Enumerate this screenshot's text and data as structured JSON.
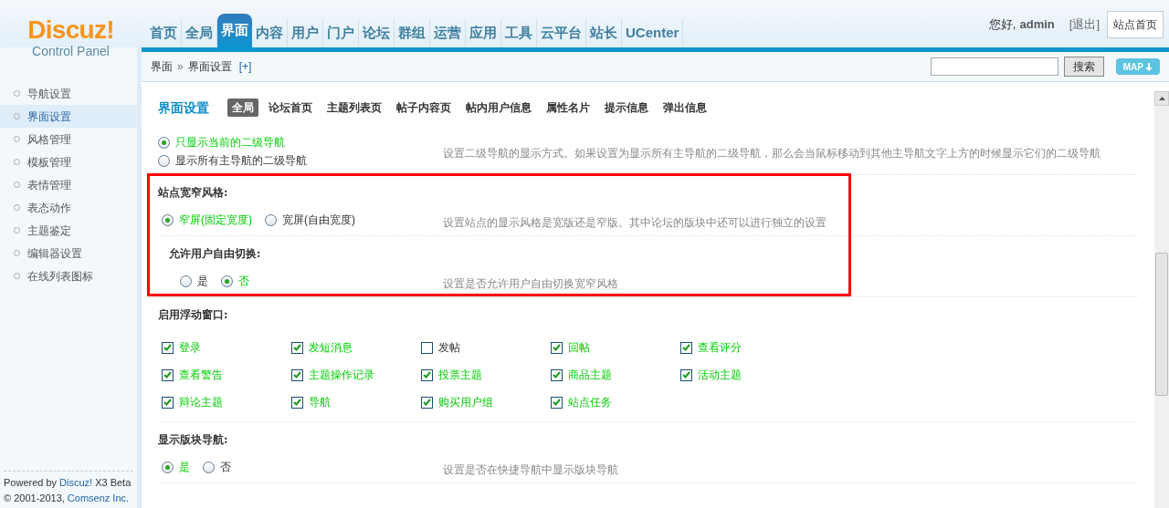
{
  "header": {
    "logo": {
      "brand": "Discuz!",
      "subtitle": "Control Panel"
    },
    "nav": [
      {
        "label": "首页",
        "selected": false
      },
      {
        "label": "全局",
        "selected": false
      },
      {
        "label": "界面",
        "selected": true
      },
      {
        "label": "内容",
        "selected": false
      },
      {
        "label": "用户",
        "selected": false
      },
      {
        "label": "门户",
        "selected": false
      },
      {
        "label": "论坛",
        "selected": false
      },
      {
        "label": "群组",
        "selected": false
      },
      {
        "label": "运营",
        "selected": false
      },
      {
        "label": "应用",
        "selected": false
      },
      {
        "label": "工具",
        "selected": false
      },
      {
        "label": "云平台",
        "selected": false
      },
      {
        "label": "站长",
        "selected": false
      },
      {
        "label": "UCenter",
        "selected": false
      }
    ],
    "greeting": "您好,",
    "username": "admin",
    "logout": "[退出]",
    "home_button": "站点首页"
  },
  "breadcrumb": {
    "items": [
      "界面",
      "界面设置"
    ],
    "separator": "»",
    "add": "[+]"
  },
  "search": {
    "button": "搜索",
    "map_button": "MAP"
  },
  "sidebar": {
    "items": [
      {
        "label": "导航设置",
        "selected": false
      },
      {
        "label": "界面设置",
        "selected": true
      },
      {
        "label": "风格管理",
        "selected": false
      },
      {
        "label": "模板管理",
        "selected": false
      },
      {
        "label": "表情管理",
        "selected": false
      },
      {
        "label": "表态动作",
        "selected": false
      },
      {
        "label": "主题鉴定",
        "selected": false
      },
      {
        "label": "编辑器设置",
        "selected": false
      },
      {
        "label": "在线列表图标",
        "selected": false
      }
    ],
    "footer": {
      "powered": "Powered by",
      "product": "Discuz!",
      "version": "X3 Beta",
      "copyright": "© 2001-2013,",
      "company": "Comsenz Inc."
    }
  },
  "page": {
    "title": "界面设置",
    "tabs": [
      {
        "label": "全局",
        "selected": true
      },
      {
        "label": "论坛首页",
        "selected": false
      },
      {
        "label": "主题列表页",
        "selected": false
      },
      {
        "label": "帖子内容页",
        "selected": false
      },
      {
        "label": "帖内用户信息",
        "selected": false
      },
      {
        "label": "属性名片",
        "selected": false
      },
      {
        "label": "提示信息",
        "selected": false
      },
      {
        "label": "弹出信息",
        "selected": false
      }
    ]
  },
  "settings": [
    {
      "kind": "radio_stacked",
      "highlighted": false,
      "options": [
        {
          "label": "只显示当前的二级导航",
          "selected": true
        },
        {
          "label": "显示所有主导航的二级导航",
          "selected": false
        }
      ],
      "description": "设置二级导航的显示方式。如果设置为显示所有主导航的二级导航，那么会当鼠标移动到其他主导航文字上方的时候显示它们的二级导航"
    },
    {
      "kind": "radio",
      "highlighted": true,
      "title": "站点宽窄风格:",
      "options": [
        {
          "label": "窄屏(固定宽度)",
          "selected": true
        },
        {
          "label": "宽屏(自由宽度)",
          "selected": false
        }
      ],
      "description": "设置站点的显示风格是宽版还是窄版。其中论坛的版块中还可以进行独立的设置"
    },
    {
      "kind": "sub_radio",
      "highlighted": true,
      "title": "允许用户自由切换:",
      "options": [
        {
          "label": "是",
          "selected": false
        },
        {
          "label": "否",
          "selected": true
        }
      ],
      "description": "设置是否允许用户自由切换宽窄风格"
    },
    {
      "kind": "checkboxes",
      "highlighted": false,
      "title": "启用浮动窗口:",
      "options": [
        {
          "label": "登录",
          "checked": true
        },
        {
          "label": "发短消息",
          "checked": true
        },
        {
          "label": "发帖",
          "checked": false
        },
        {
          "label": "回帖",
          "checked": true
        },
        {
          "label": "查看评分",
          "checked": true
        },
        {
          "label": "查看警告",
          "checked": true
        },
        {
          "label": "主题操作记录",
          "checked": true
        },
        {
          "label": "投票主题",
          "checked": true
        },
        {
          "label": "商品主题",
          "checked": true
        },
        {
          "label": "活动主题",
          "checked": true
        },
        {
          "label": "辩论主题",
          "checked": true
        },
        {
          "label": "导航",
          "checked": true
        },
        {
          "label": "购买用户组",
          "checked": true
        },
        {
          "label": "站点任务",
          "checked": true
        }
      ]
    },
    {
      "kind": "radio",
      "highlighted": false,
      "title": "显示版块导航:",
      "options": [
        {
          "label": "是",
          "selected": true
        },
        {
          "label": "否",
          "selected": false
        }
      ],
      "description": "设置是否在快捷导航中显示版块导航"
    }
  ]
}
